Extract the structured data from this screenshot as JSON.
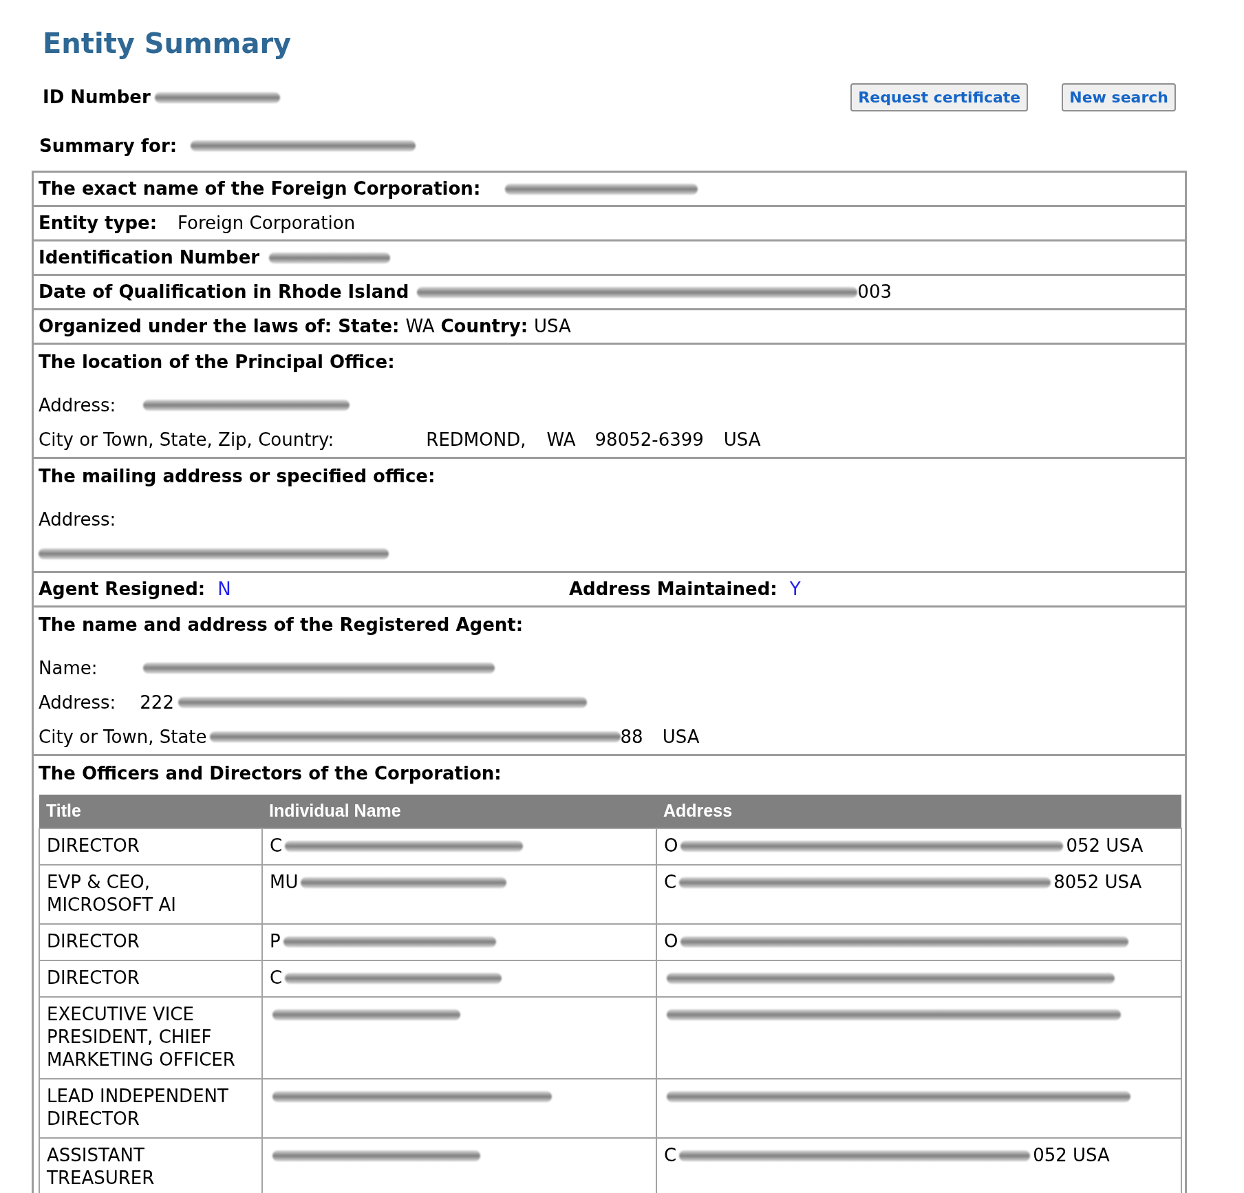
{
  "page": {
    "title": "Entity Summary"
  },
  "id_number": {
    "label": "ID Number",
    "value": [
      {
        "kind": "redacted"
      }
    ]
  },
  "actions": [
    {
      "label": "Request certificate"
    },
    {
      "label": "New search"
    }
  ],
  "summary_for": {
    "label": "Summary for:",
    "value": [
      {
        "kind": "redacted"
      }
    ]
  },
  "record": [
    {
      "kind": "line",
      "parts": [
        {
          "kind": "label",
          "text": "The exact name of the Foreign Corporation:"
        },
        {
          "kind": "redacted"
        }
      ]
    },
    {
      "kind": "line",
      "parts": [
        {
          "kind": "label",
          "text": "Entity type:"
        },
        {
          "kind": "text",
          "text": "Foreign Corporation"
        }
      ]
    },
    {
      "kind": "line",
      "parts": [
        {
          "kind": "label",
          "text": "Identification Number"
        },
        {
          "kind": "redacted"
        }
      ]
    },
    {
      "kind": "line",
      "parts": [
        {
          "kind": "label",
          "text": "Date of Qualification in Rhode Island"
        },
        {
          "kind": "redacted"
        },
        {
          "kind": "text",
          "text": "003"
        }
      ]
    },
    {
      "kind": "line",
      "parts": [
        {
          "kind": "label",
          "text": "Organized under the laws of:"
        },
        {
          "kind": "label",
          "text": "State:"
        },
        {
          "kind": "text",
          "text": "WA"
        },
        {
          "kind": "label",
          "text": "Country:"
        },
        {
          "kind": "text",
          "text": "USA"
        }
      ]
    },
    {
      "kind": "block",
      "heading": "The location of the Principal Office:",
      "lines": [
        [
          {
            "kind": "caption",
            "text": "Address:"
          },
          {
            "kind": "redacted"
          }
        ],
        [
          {
            "kind": "caption",
            "text": "City or Town, State, Zip, Country:"
          },
          {
            "kind": "text",
            "text": "REDMOND,"
          },
          {
            "kind": "text",
            "text": "WA"
          },
          {
            "kind": "text",
            "text": "98052-6399"
          },
          {
            "kind": "text",
            "text": "USA"
          }
        ]
      ]
    },
    {
      "kind": "block",
      "heading": "The mailing address or specified office:",
      "lines": [
        [
          {
            "kind": "caption",
            "text": "Address:"
          }
        ],
        [
          {
            "kind": "redacted"
          }
        ]
      ]
    },
    {
      "kind": "flags",
      "items": [
        {
          "label": "Agent Resigned:",
          "value": "N"
        },
        {
          "label": "Address Maintained:",
          "value": "Y"
        }
      ]
    },
    {
      "kind": "block",
      "heading": "The name and address of the Registered Agent:",
      "lines": [
        [
          {
            "kind": "caption",
            "text": "Name:"
          },
          {
            "kind": "redacted"
          }
        ],
        [
          {
            "kind": "caption",
            "text": "Address:"
          },
          {
            "kind": "text",
            "text": "222"
          },
          {
            "kind": "redacted"
          }
        ],
        [
          {
            "kind": "caption",
            "text": "City or Town, State"
          },
          {
            "kind": "redacted"
          },
          {
            "kind": "text",
            "text": "88"
          },
          {
            "kind": "text",
            "text": "USA"
          }
        ]
      ]
    },
    {
      "kind": "officers",
      "heading": "The Officers and Directors of the Corporation:",
      "table": {
        "columns": [
          "Title",
          "Individual Name",
          "Address"
        ],
        "rows": [
          [
            [
              {
                "kind": "text",
                "text": "DIRECTOR"
              }
            ],
            [
              {
                "kind": "text",
                "text": "C"
              },
              {
                "kind": "redacted"
              }
            ],
            [
              {
                "kind": "text",
                "text": "O"
              },
              {
                "kind": "redacted"
              },
              {
                "kind": "text",
                "text": "052 USA"
              }
            ]
          ],
          [
            [
              {
                "kind": "text",
                "text": "EVP & CEO, MICROSOFT AI"
              }
            ],
            [
              {
                "kind": "text",
                "text": "MU"
              },
              {
                "kind": "redacted"
              }
            ],
            [
              {
                "kind": "text",
                "text": "C"
              },
              {
                "kind": "redacted"
              },
              {
                "kind": "text",
                "text": "8052 USA"
              }
            ]
          ],
          [
            [
              {
                "kind": "text",
                "text": "DIRECTOR"
              }
            ],
            [
              {
                "kind": "text",
                "text": "P"
              },
              {
                "kind": "redacted"
              }
            ],
            [
              {
                "kind": "text",
                "text": "O"
              },
              {
                "kind": "redacted"
              }
            ]
          ],
          [
            [
              {
                "kind": "text",
                "text": "DIRECTOR"
              }
            ],
            [
              {
                "kind": "text",
                "text": "C"
              },
              {
                "kind": "redacted"
              }
            ],
            [
              {
                "kind": "redacted"
              }
            ]
          ],
          [
            [
              {
                "kind": "text",
                "text": "EXECUTIVE VICE PRESIDENT, CHIEF MARKETING OFFICER"
              }
            ],
            [
              {
                "kind": "redacted"
              }
            ],
            [
              {
                "kind": "redacted"
              }
            ]
          ],
          [
            [
              {
                "kind": "text",
                "text": "LEAD INDEPENDENT DIRECTOR"
              }
            ],
            [
              {
                "kind": "redacted"
              }
            ],
            [
              {
                "kind": "redacted"
              }
            ]
          ],
          [
            [
              {
                "kind": "text",
                "text": "ASSISTANT TREASURER"
              }
            ],
            [
              {
                "kind": "redacted"
              }
            ],
            [
              {
                "kind": "text",
                "text": "C"
              },
              {
                "kind": "redacted"
              },
              {
                "kind": "text",
                "text": "052 USA"
              }
            ]
          ]
        ]
      }
    }
  ]
}
